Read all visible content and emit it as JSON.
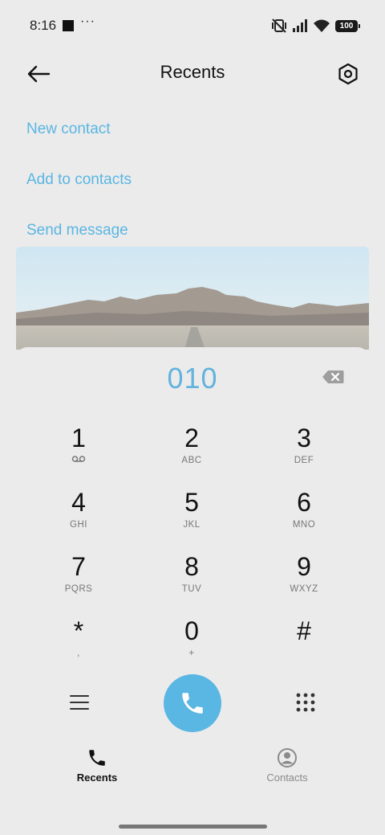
{
  "status_bar": {
    "time": "8:16",
    "overflow_indicator": "···",
    "battery_level": "100",
    "icons": [
      "notification-square-icon",
      "mute-vibrate-icon",
      "signal-icon",
      "wifi-icon",
      "battery-icon"
    ]
  },
  "header": {
    "title": "Recents",
    "back_icon": "arrow-left-icon",
    "settings_icon": "hexagon-settings-icon"
  },
  "actions": [
    {
      "label": "New contact"
    },
    {
      "label": "Add to contacts"
    },
    {
      "label": "Send message"
    }
  ],
  "banner": {
    "image": "desert-mountains-landscape"
  },
  "dialer": {
    "number": "010",
    "delete_icon": "backspace-icon",
    "keys": [
      {
        "digit": "1",
        "letters": ""
      },
      {
        "digit": "2",
        "letters": "ABC"
      },
      {
        "digit": "3",
        "letters": "DEF"
      },
      {
        "digit": "4",
        "letters": "GHI"
      },
      {
        "digit": "5",
        "letters": "JKL"
      },
      {
        "digit": "6",
        "letters": "MNO"
      },
      {
        "digit": "7",
        "letters": "PQRS"
      },
      {
        "digit": "8",
        "letters": "TUV"
      },
      {
        "digit": "9",
        "letters": "WXYZ"
      },
      {
        "digit": "*",
        "letters": ","
      },
      {
        "digit": "0",
        "letters": "+"
      },
      {
        "digit": "#",
        "letters": ""
      }
    ],
    "voicemail_icon": "voicemail-icon",
    "menu_icon": "hamburger-menu-icon",
    "call_icon": "phone-icon",
    "keypad_icon": "dialpad-icon"
  },
  "tabs": [
    {
      "label": "Recents",
      "icon": "phone-icon",
      "active": true
    },
    {
      "label": "Contacts",
      "icon": "person-circle-icon",
      "active": false
    }
  ],
  "colors": {
    "accent": "#5ab6e3",
    "background": "#ebebeb",
    "text": "#111111",
    "secondary_text": "#777777"
  }
}
